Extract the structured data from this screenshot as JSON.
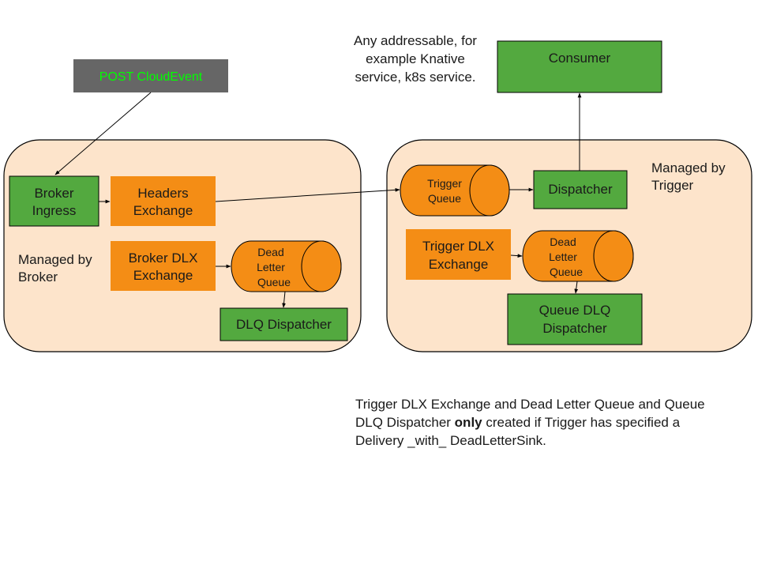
{
  "colors": {
    "green": "#53a93f",
    "orange": "#f48d15",
    "group_fill": "#fde4cb",
    "source_fill": "#666666",
    "source_text": "#00ff00",
    "stroke": "#000000"
  },
  "source": {
    "label": "POST CloudEvent"
  },
  "broker_group": {
    "label_lines": [
      "Managed by",
      "Broker"
    ],
    "ingress": {
      "lines": [
        "Broker",
        "Ingress"
      ]
    },
    "headers_exchange": {
      "lines": [
        "Headers",
        "Exchange"
      ]
    },
    "dlx_exchange": {
      "lines": [
        "Broker DLX",
        "Exchange"
      ]
    },
    "dead_letter_queue": {
      "lines": [
        "Dead",
        "Letter",
        "Queue"
      ]
    },
    "dlq_dispatcher": {
      "lines": [
        "DLQ Dispatcher"
      ]
    }
  },
  "trigger_group": {
    "label_lines": [
      "Managed by",
      "Trigger"
    ],
    "trigger_queue": {
      "lines": [
        "Trigger",
        "Queue"
      ]
    },
    "dispatcher": {
      "lines": [
        "Dispatcher"
      ]
    },
    "dlx_exchange": {
      "lines": [
        "Trigger DLX",
        "Exchange"
      ]
    },
    "dead_letter_queue": {
      "lines": [
        "Dead",
        "Letter",
        "Queue"
      ]
    },
    "queue_dlq_dispatcher": {
      "lines": [
        "Queue DLQ",
        "Dispatcher"
      ]
    }
  },
  "consumer": {
    "lines": [
      "Consumer"
    ]
  },
  "notes": {
    "addressable": "Any addressable, for example Knative service, k8s service.",
    "footer_before": "Trigger DLX Exchange and Dead Letter Queue and Queue DLQ Dispatcher ",
    "footer_bold": "only",
    "footer_after": " created if Trigger has specified a Delivery _with_ DeadLetterSink."
  }
}
